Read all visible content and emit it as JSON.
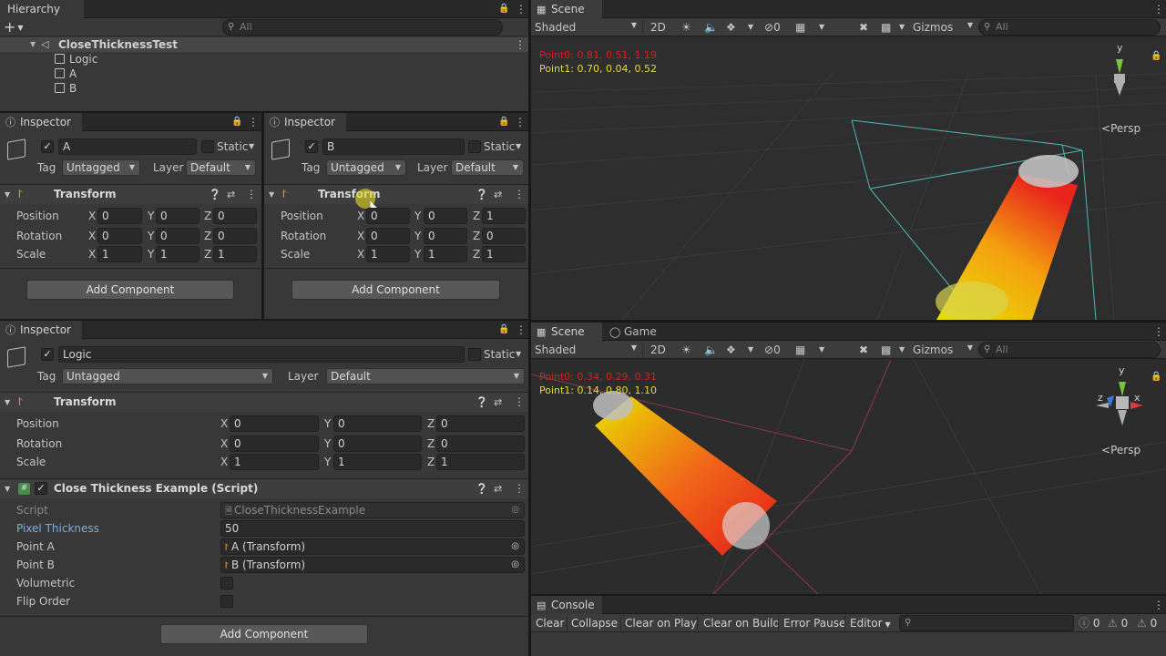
{
  "hierarchy": {
    "tab": "Hierarchy",
    "add": "+",
    "search_placeholder": "All",
    "scene": "CloseThicknessTest",
    "items": [
      "Logic",
      "A",
      "B"
    ]
  },
  "inspector_a": {
    "tab": "Inspector",
    "name": "A",
    "static": "Static",
    "tag_label": "Tag",
    "tag": "Untagged",
    "layer_label": "Layer",
    "layer": "Default",
    "component": "Transform",
    "rows": [
      {
        "label": "Position",
        "x": "0",
        "y": "0",
        "z": "0"
      },
      {
        "label": "Rotation",
        "x": "0",
        "y": "0",
        "z": "0"
      },
      {
        "label": "Scale",
        "x": "1",
        "y": "1",
        "z": "1"
      }
    ],
    "add_component": "Add Component"
  },
  "inspector_b": {
    "tab": "Inspector",
    "name": "B",
    "static": "Static",
    "tag_label": "Tag",
    "tag": "Untagged",
    "layer_label": "Layer",
    "layer": "Default",
    "component": "Transform",
    "rows": [
      {
        "label": "Position",
        "x": "0",
        "y": "0",
        "z": "1"
      },
      {
        "label": "Rotation",
        "x": "0",
        "y": "0",
        "z": "0"
      },
      {
        "label": "Scale",
        "x": "1",
        "y": "1",
        "z": "1"
      }
    ],
    "add_component": "Add Component"
  },
  "inspector_logic": {
    "tab": "Inspector",
    "name": "Logic",
    "static": "Static",
    "tag_label": "Tag",
    "tag": "Untagged",
    "layer_label": "Layer",
    "layer": "Default",
    "component": "Transform",
    "rows": [
      {
        "label": "Position",
        "x": "0",
        "y": "0",
        "z": "0"
      },
      {
        "label": "Rotation",
        "x": "0",
        "y": "0",
        "z": "0"
      },
      {
        "label": "Scale",
        "x": "1",
        "y": "1",
        "z": "1"
      }
    ],
    "script_component": "Close Thickness Example (Script)",
    "script_label": "Script",
    "script_value": "CloseThicknessExample",
    "pixel_label": "Pixel Thickness",
    "pixel_value": "50",
    "point_a_label": "Point A",
    "point_a_value": "A (Transform)",
    "point_b_label": "Point B",
    "point_b_value": "B (Transform)",
    "volumetric_label": "Volumetric",
    "flip_label": "Flip Order",
    "add_component": "Add Component"
  },
  "axis": {
    "x": "X",
    "y": "Y",
    "z": "Z"
  },
  "scene_top": {
    "tab": "Scene",
    "shading": "Shaded",
    "mode_2d": "2D",
    "hidden_count": "0",
    "gizmos": "Gizmos",
    "search_placeholder": "All",
    "point0": "Point0: 0.81, 0.51, 1.19",
    "point1": "Point1: 0.70, 0.04, 0.52",
    "persp": "Persp",
    "gizmo_axis": "y"
  },
  "scene_bottom": {
    "tab": "Scene",
    "tab2": "Game",
    "shading": "Shaded",
    "mode_2d": "2D",
    "hidden_count": "0",
    "gizmos": "Gizmos",
    "search_placeholder": "All",
    "point0": "Point0: 0.34, 0.29, 0.31",
    "point1": "Point1: 0.14, 0.80, 1.10",
    "persp": "Persp",
    "gizmo_y": "y",
    "gizmo_z": "z",
    "gizmo_x": "x"
  },
  "console": {
    "tab": "Console",
    "clear": "Clear",
    "collapse": "Collapse",
    "clear_on_play": "Clear on Play",
    "clear_on_build": "Clear on Build",
    "error_pause": "Error Pause",
    "editor": "Editor",
    "log_count": "0",
    "warn_count": "0",
    "error_count": "0"
  },
  "colors": {
    "point0": "#d42020",
    "point1": "#e5d93a",
    "gizmo_y": "#7bc43a",
    "gizmo_x": "#d93b3b",
    "gizmo_z": "#3a7bd9"
  }
}
